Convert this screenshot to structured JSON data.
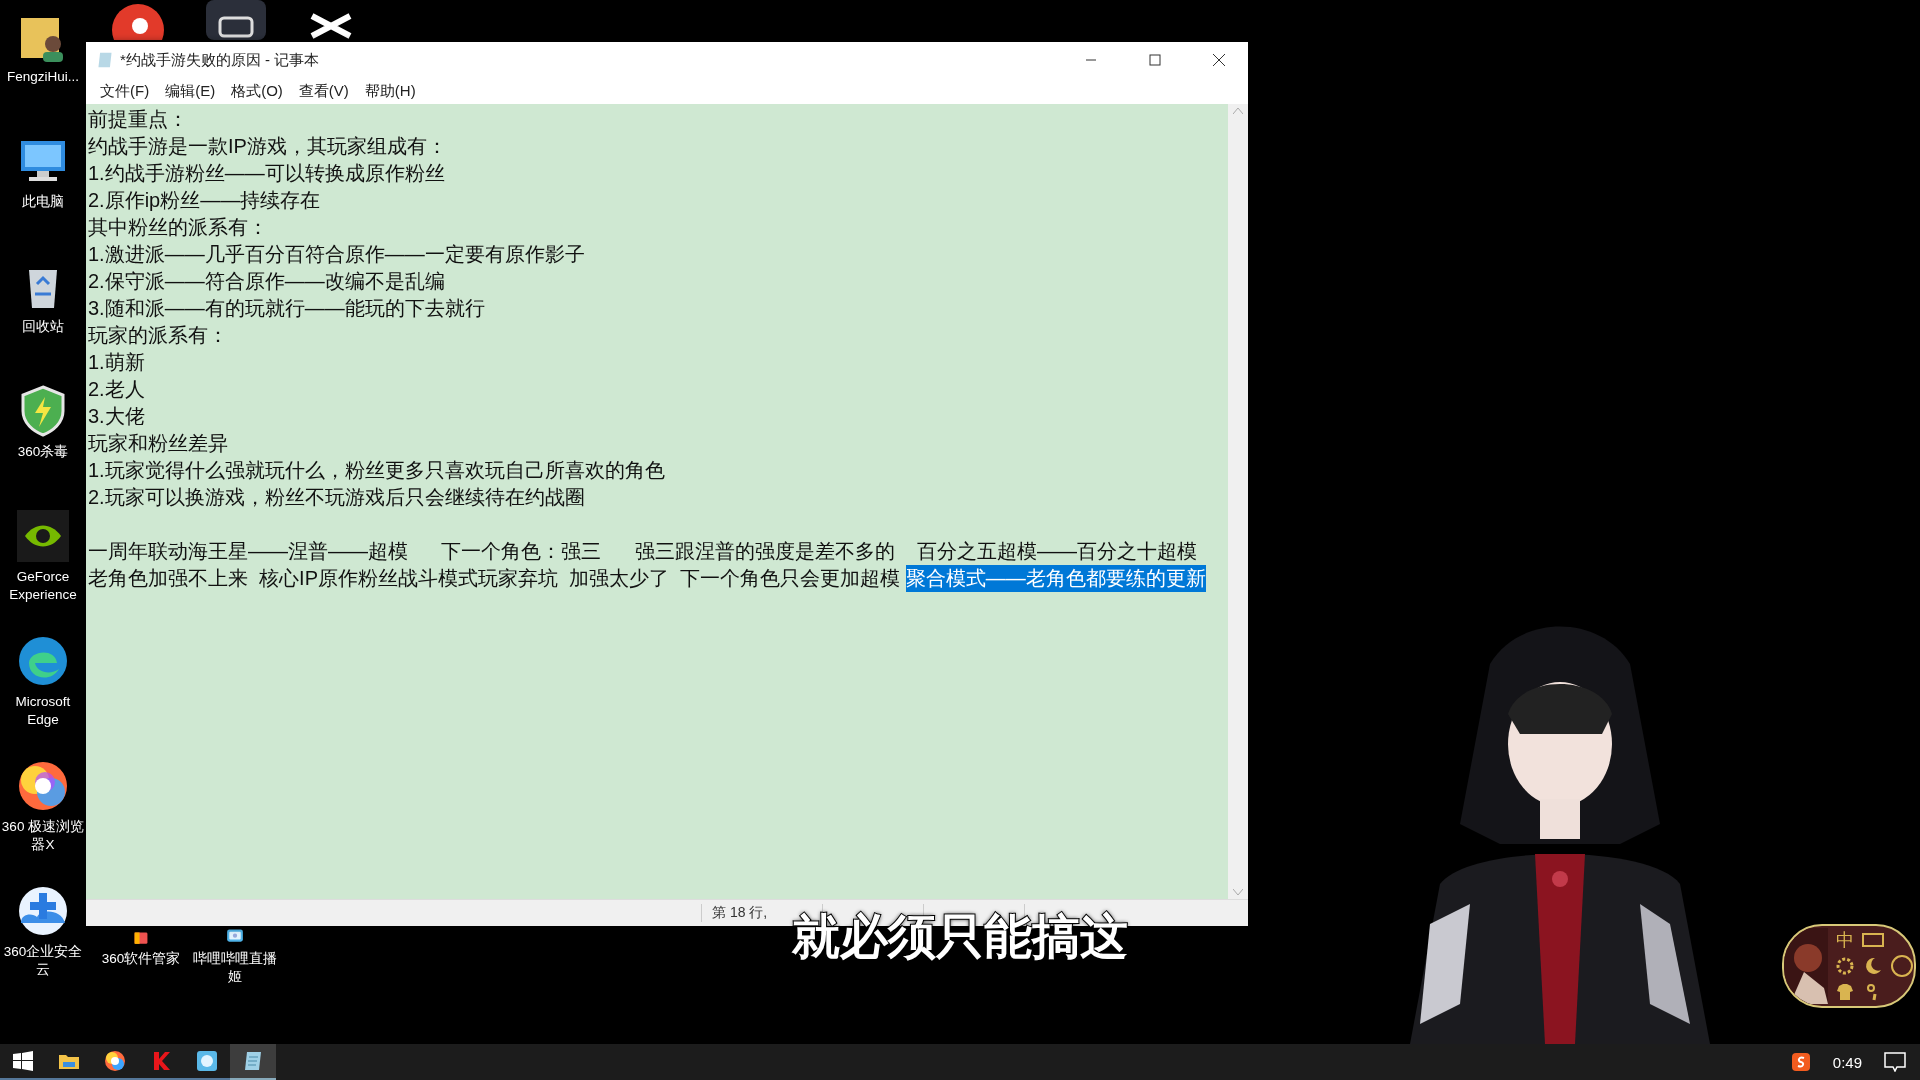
{
  "desktop_icons": [
    {
      "label": "FengziHui...",
      "kind": "user"
    },
    {
      "label": "此电脑",
      "kind": "computer"
    },
    {
      "label": "回收站",
      "kind": "bin"
    },
    {
      "label": "360杀毒",
      "kind": "shield"
    },
    {
      "label": "GeForce Experience",
      "kind": "nvidia"
    },
    {
      "label": "Microsoft Edge",
      "kind": "edge"
    },
    {
      "label": "360 极速浏览器X",
      "kind": "swirl"
    },
    {
      "label": "360企业安全云",
      "kind": "plus"
    },
    {
      "label": "360软件管家",
      "kind": "bag"
    },
    {
      "label": "哔哩哔哩直播姬",
      "kind": "tv"
    }
  ],
  "window": {
    "title": "*约战手游失败的原因 - 记事本",
    "menu": [
      "文件(F)",
      "编辑(E)",
      "格式(O)",
      "查看(V)",
      "帮助(H)"
    ],
    "lines": [
      {
        "kind": "text",
        "spans": [
          {
            "text": "前提重点：",
            "selected": false
          }
        ]
      },
      {
        "kind": "text",
        "spans": [
          {
            "text": "约战手游是一款IP游戏，其玩家组成有：",
            "selected": false
          }
        ]
      },
      {
        "kind": "text",
        "spans": [
          {
            "text": "1.约战手游粉丝——可以转换成原作粉丝",
            "selected": false
          }
        ]
      },
      {
        "kind": "text",
        "spans": [
          {
            "text": "2.原作ip粉丝——持续存在",
            "selected": false
          }
        ]
      },
      {
        "kind": "text",
        "spans": [
          {
            "text": "其中粉丝的派系有：",
            "selected": false
          }
        ]
      },
      {
        "kind": "text",
        "spans": [
          {
            "text": "1.激进派——几乎百分百符合原作——一定要有原作影子",
            "selected": false
          }
        ]
      },
      {
        "kind": "text",
        "spans": [
          {
            "text": "2.保守派——符合原作——改编不是乱编",
            "selected": false
          }
        ]
      },
      {
        "kind": "text",
        "spans": [
          {
            "text": "3.随和派——有的玩就行——能玩的下去就行",
            "selected": false
          }
        ]
      },
      {
        "kind": "text",
        "spans": [
          {
            "text": "玩家的派系有：",
            "selected": false
          }
        ]
      },
      {
        "kind": "text",
        "spans": [
          {
            "text": "1.萌新",
            "selected": false
          }
        ]
      },
      {
        "kind": "text",
        "spans": [
          {
            "text": "2.老人",
            "selected": false
          }
        ]
      },
      {
        "kind": "text",
        "spans": [
          {
            "text": "3.大佬",
            "selected": false
          }
        ]
      },
      {
        "kind": "text",
        "spans": [
          {
            "text": "玩家和粉丝差异",
            "selected": false
          }
        ]
      },
      {
        "kind": "text",
        "spans": [
          {
            "text": "1.玩家觉得什么强就玩什么，粉丝更多只喜欢玩自己所喜欢的角色",
            "selected": false
          }
        ]
      },
      {
        "kind": "text",
        "spans": [
          {
            "text": "2.玩家可以换游戏，粉丝不玩游戏后只会继续待在约战圈",
            "selected": false
          }
        ]
      },
      {
        "kind": "blank"
      },
      {
        "kind": "text",
        "spans": [
          {
            "text": "一周年联动海王星——涅普——超模      下一个角色：强三      强三跟涅普的强度是差不多的    百分之五超模——百分之十超模",
            "selected": false
          }
        ]
      },
      {
        "kind": "text",
        "spans": [
          {
            "text": "老角色加强不上来  核心IP原作粉丝战斗模式玩家弃坑  加强太少了  下一个角色只会更加超模 ",
            "selected": false
          },
          {
            "text": "聚合模式——老角色都要练的更新",
            "selected": true
          }
        ]
      }
    ],
    "status_bar": [
      "第 18 行,"
    ]
  },
  "subtitle": "就必须只能搞这",
  "ime_toolbar": {
    "label": "中"
  },
  "taskbar": {
    "apps": [
      {
        "kind": "start",
        "selected": false
      },
      {
        "kind": "folder",
        "selected": false
      },
      {
        "kind": "swirl",
        "selected": false
      },
      {
        "kind": "k",
        "selected": false
      },
      {
        "kind": "tv",
        "selected": false
      },
      {
        "kind": "notepad",
        "selected": true
      }
    ],
    "clock": "0:49"
  }
}
